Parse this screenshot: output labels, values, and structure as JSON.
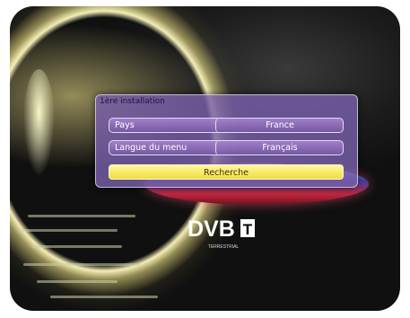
{
  "menu": {
    "title": "1ère installation",
    "rows": [
      {
        "label": "Pays",
        "value": "France"
      },
      {
        "label": "Langue du menu",
        "value": "Français"
      }
    ],
    "search_button": "Recherche"
  },
  "logo": {
    "brand": "DVB",
    "letter": "T",
    "subtitle": "TERRESTRIAL"
  },
  "colors": {
    "panel": "#7a5faa",
    "highlight": "#f1dd3a"
  }
}
